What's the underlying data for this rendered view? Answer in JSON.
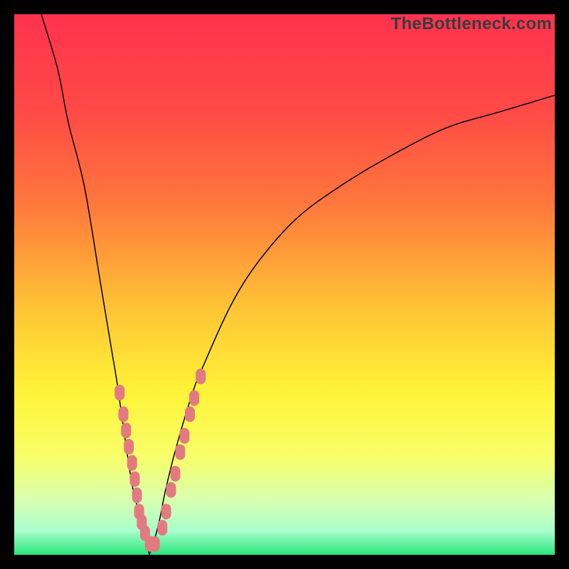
{
  "watermark": "TheBottleneck.com",
  "colors": {
    "gradient_stops": [
      {
        "offset": 0.0,
        "color": "#ff324f"
      },
      {
        "offset": 0.18,
        "color": "#ff4a46"
      },
      {
        "offset": 0.35,
        "color": "#ff773c"
      },
      {
        "offset": 0.55,
        "color": "#ffc635"
      },
      {
        "offset": 0.7,
        "color": "#fff338"
      },
      {
        "offset": 0.82,
        "color": "#f8ff6a"
      },
      {
        "offset": 0.9,
        "color": "#d6ffb0"
      },
      {
        "offset": 0.955,
        "color": "#abffce"
      },
      {
        "offset": 1.0,
        "color": "#29e57b"
      }
    ],
    "curve": "#000000",
    "marker": "#e37a81"
  },
  "chart_data": {
    "type": "line",
    "title": "",
    "xlabel": "",
    "ylabel": "",
    "xlim": [
      0,
      100
    ],
    "ylim": [
      0,
      100
    ],
    "x_min_at": 25,
    "left": {
      "x": [
        5,
        8,
        10,
        13,
        16,
        18,
        19,
        20,
        21,
        22,
        23,
        24,
        25
      ],
      "y": [
        100,
        90,
        80,
        68,
        50,
        38,
        32,
        25,
        18,
        12,
        8,
        4,
        0
      ]
    },
    "right": {
      "x": [
        25,
        26,
        27,
        28,
        30,
        33,
        35,
        40,
        45,
        52,
        60,
        70,
        80,
        90,
        100
      ],
      "y": [
        0,
        3,
        7,
        12,
        20,
        30,
        35,
        46,
        54,
        62,
        68,
        74,
        79,
        82,
        85
      ]
    },
    "markers": {
      "x": [
        19.5,
        20.2,
        20.7,
        21.2,
        21.8,
        22.3,
        22.7,
        23.1,
        23.6,
        24.2,
        25.1,
        26.0,
        27.4,
        28.1,
        29.0,
        29.8,
        30.7,
        31.5,
        32.5,
        33.3,
        34.5
      ],
      "y": [
        30,
        26,
        23,
        20,
        17,
        14,
        11,
        8,
        6,
        4,
        2,
        2,
        5,
        8,
        12,
        15,
        19,
        22,
        26,
        29,
        33
      ]
    }
  }
}
